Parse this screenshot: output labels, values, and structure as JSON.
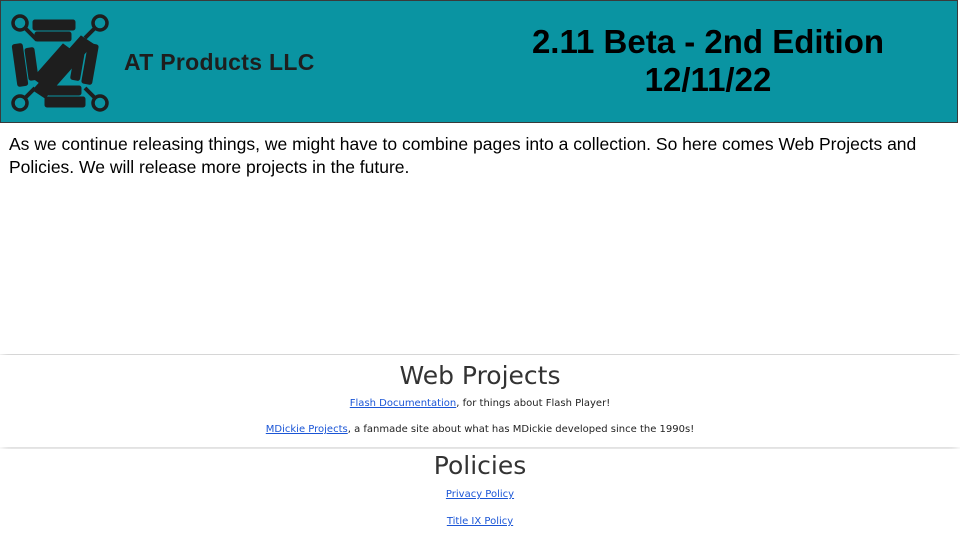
{
  "header": {
    "brand": "AT Products LLC",
    "edition_line1": "2.11 Beta - 2nd Edition",
    "edition_line2": "12/11/22",
    "logo_icon": "circuit-logo-icon",
    "background_color": "#0a94a2"
  },
  "intro": {
    "text": "As we continue releasing things, we might have to combine pages into a collection. So here comes Web Projects and Policies. We will release more projects in the future."
  },
  "web_projects": {
    "title": "Web Projects",
    "items": [
      {
        "link": "Flash Documentation",
        "text": ", for things about Flash Player!"
      },
      {
        "link": "MDickie Projects",
        "text": ", a fanmade site about what has MDickie developed since the 1990s!"
      }
    ]
  },
  "policies": {
    "title": "Policies",
    "links": [
      "Privacy Policy",
      "Title IX Policy"
    ]
  },
  "colors": {
    "link": "#1a55d6"
  }
}
